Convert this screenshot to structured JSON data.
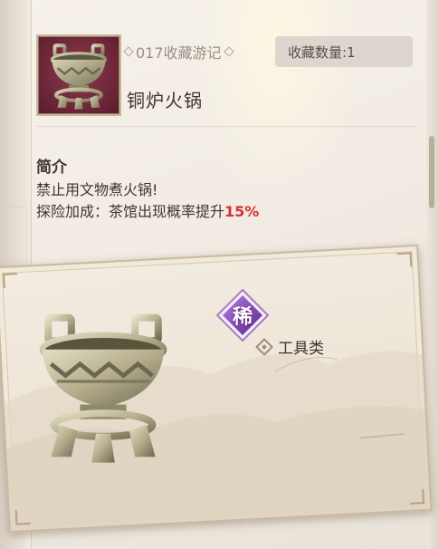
{
  "item": {
    "serial": "017收藏游记",
    "count": "收藏数量:1",
    "name": "铜炉火锅",
    "icon": "bronze-cauldron-icon"
  },
  "intro": {
    "title": "简介",
    "line1": "禁止用文物煮火锅!",
    "line2_prefix": "探险加成：茶馆出现概率提升",
    "line2_value": "15%"
  },
  "card": {
    "rarity_char": "稀",
    "category": "工具类"
  },
  "colors": {
    "accent_red": "#d3302f",
    "rarity_purple": "#7a3fb0",
    "thumb_bg": "#6a2436"
  }
}
